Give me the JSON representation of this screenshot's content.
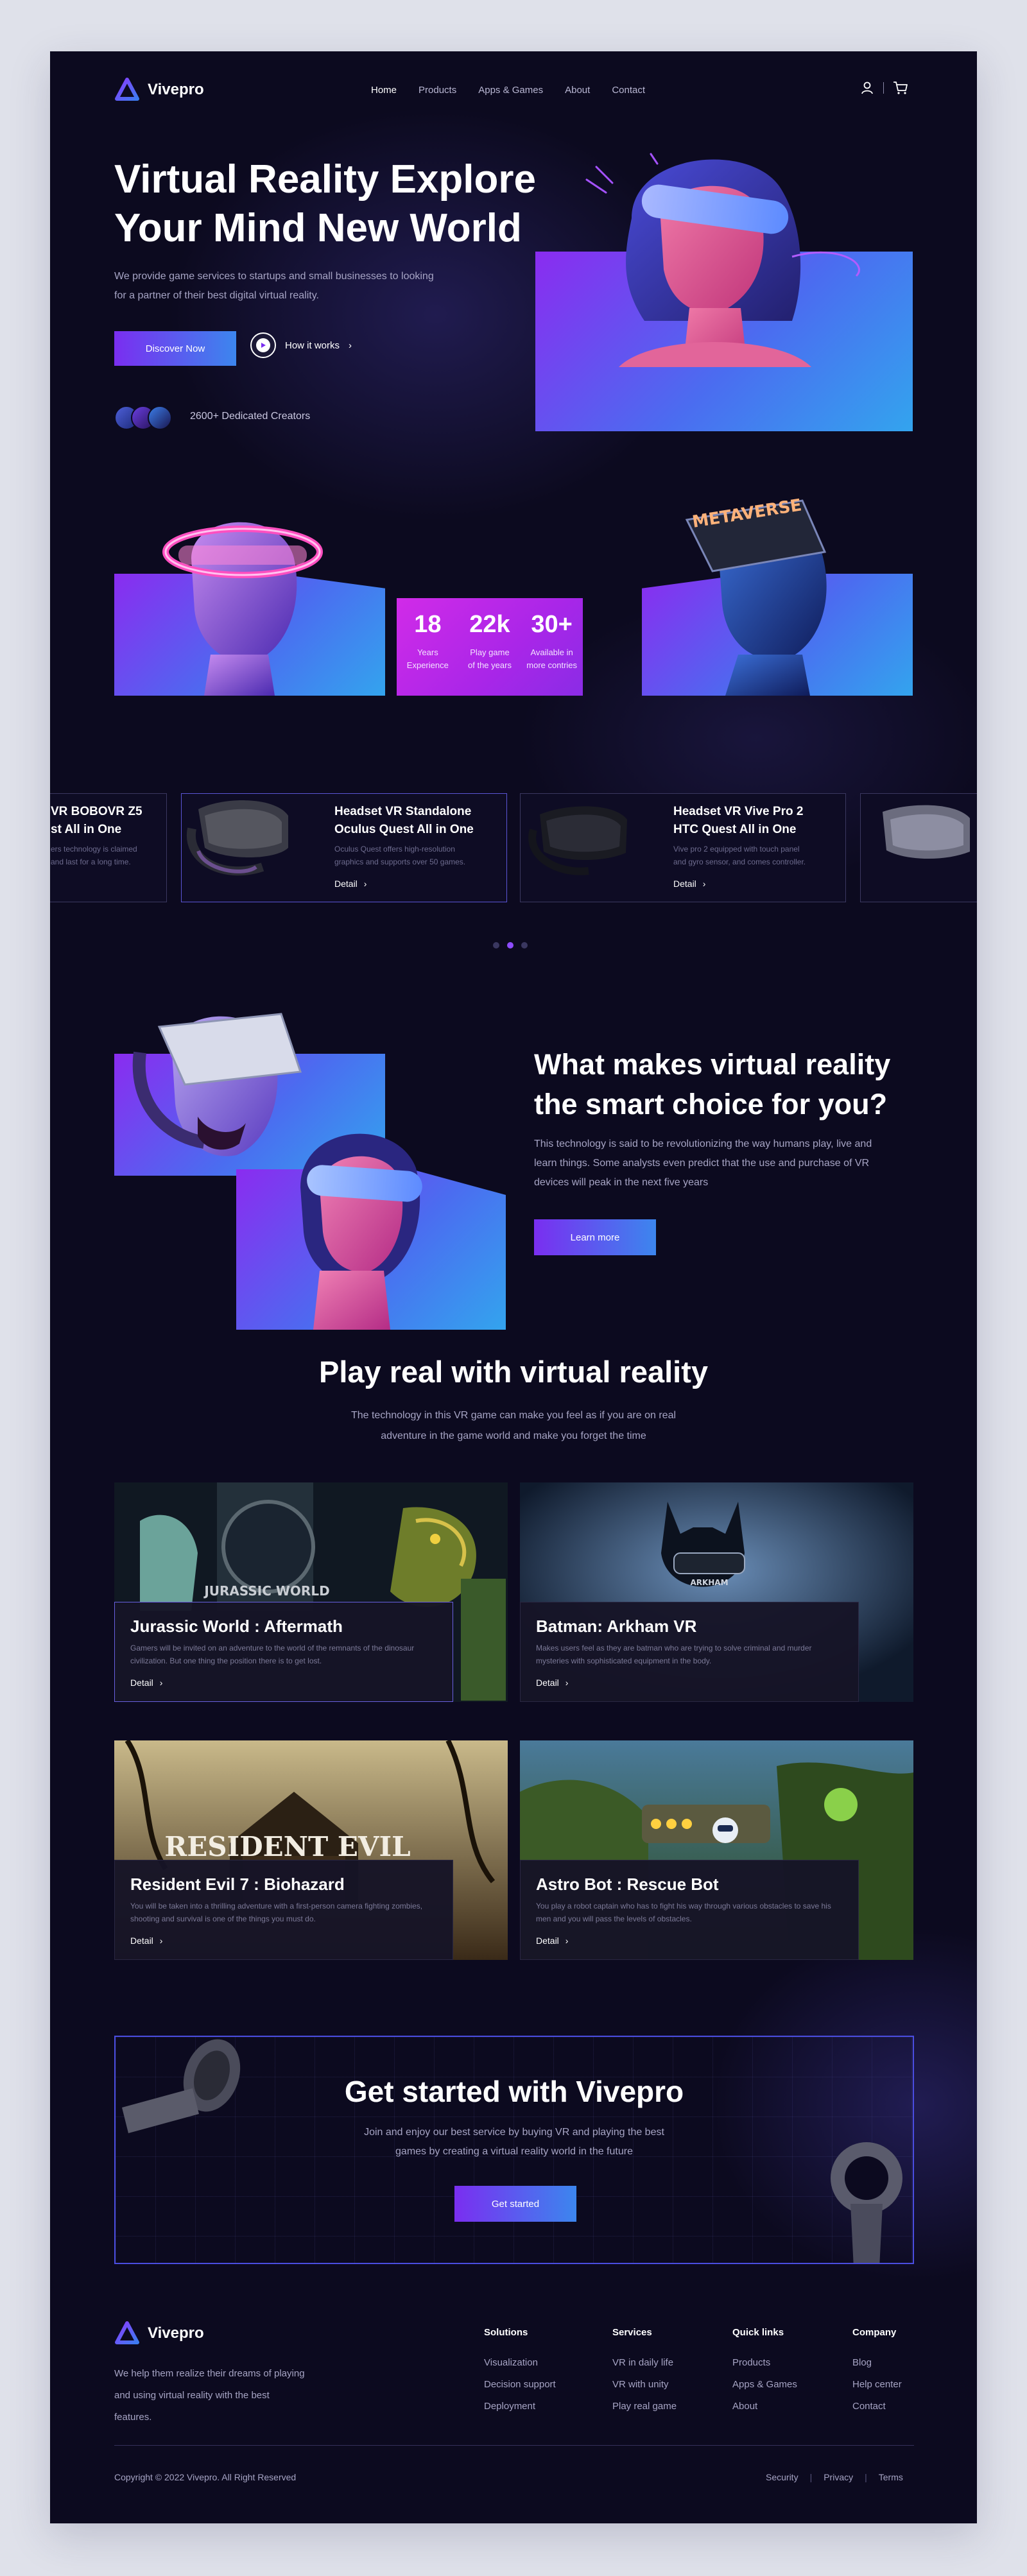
{
  "brand": {
    "name": "Vivepro",
    "accent": "#7a2ef0",
    "accent2": "#3c86ee"
  },
  "nav": {
    "items": [
      "Home",
      "Products",
      "Apps & Games",
      "About",
      "Contact"
    ]
  },
  "hero": {
    "title_line1": "Virtual Reality Explore",
    "title_line2": "Your Mind New World",
    "desc": "We provide game services to startups and small businesses to looking for a partner of their best digital virtual reality.",
    "cta_primary": "Discover Now",
    "cta_secondary": "How it works",
    "creators": "2600+ Dedicated Creators",
    "metaverse_label": "METAVERSE"
  },
  "stats": [
    {
      "value": "18",
      "label_line1": "Years",
      "label_line2": "Experience"
    },
    {
      "value": "22k",
      "label_line1": "Play game",
      "label_line2": "of the years"
    },
    {
      "value": "30+",
      "label_line1": "Available in",
      "label_line2": "more contries"
    }
  ],
  "products": [
    {
      "title_line1": "VR BOBOVR Z5",
      "title_line2": "st All in One",
      "desc_line1": "ers technology is claimed",
      "desc_line2": "and last for a long time.",
      "link": ""
    },
    {
      "title_line1": "Headset VR Standalone",
      "title_line2": "Oculus Quest All in One",
      "desc_line1": "Oculus Quest offers high-resolution",
      "desc_line2": "graphics and supports over 50 games.",
      "link": "Detail"
    },
    {
      "title_line1": "Headset VR Vive Pro 2",
      "title_line2": "HTC Quest All in One",
      "desc_line1": "Vive pro 2 equipped with touch panel",
      "desc_line2": "and gyro sensor, and comes controller.",
      "link": "Detail"
    }
  ],
  "smart": {
    "title_line1": "What makes virtual reality",
    "title_line2": "the smart choice for you?",
    "desc": "This technology is said to be revolutionizing the way humans play, live and learn things. Some analysts even predict that the use and purchase of VR devices will peak in the next five years",
    "cta": "Learn more"
  },
  "play": {
    "title": "Play real with virtual reality",
    "desc": "The technology in this VR game can make you feel as if you are on real adventure in the game world and make you forget the time"
  },
  "games": [
    {
      "title": "Jurassic World : Aftermath",
      "desc": "Gamers will be invited on an adventure to the world of the remnants of the dinosaur civilization. But one thing the position there is to get lost.",
      "link": "Detail",
      "art_text": "JURASSIC WORLD"
    },
    {
      "title": "Batman: Arkham VR",
      "desc": "Makes users feel as they are batman who are trying to solve criminal and murder mysteries with sophisticated equipment in the body.",
      "link": "Detail",
      "art_text": "ARKHAM"
    },
    {
      "title": "Resident Evil 7 : Biohazard",
      "desc": "You will be taken into a thrilling adventure with a first-person camera fighting zombies, shooting and survival is one of the things you must do.",
      "link": "Detail",
      "art_text": "RESIDENT EVIL"
    },
    {
      "title": "Astro Bot : Rescue Bot",
      "desc": "You play a robot captain who has to fight his way through various obstacles to save his men and you will pass the levels of obstacles.",
      "link": "Detail",
      "art_text": ""
    }
  ],
  "cta": {
    "title": "Get started with Vivepro",
    "desc": "Join and enjoy our best service by buying VR and playing the best games by creating a virtual reality world in the future",
    "button": "Get started"
  },
  "footer": {
    "desc": "We help them realize their dreams of playing and using virtual reality with the best features.",
    "columns": [
      {
        "title": "Solutions",
        "items": [
          "Visualization",
          "Decision support",
          "Deployment"
        ]
      },
      {
        "title": "Services",
        "items": [
          "VR in daily life",
          "VR with unity",
          "Play real game"
        ]
      },
      {
        "title": "Quick links",
        "items": [
          "Products",
          "Apps & Games",
          "About"
        ]
      },
      {
        "title": "Company",
        "items": [
          "Blog",
          "Help center",
          "Contact"
        ]
      }
    ],
    "copyright": "Copyright © 2022 Vivepro. All Right Reserved",
    "legal": [
      "Security",
      "Privacy",
      "Terms"
    ]
  }
}
